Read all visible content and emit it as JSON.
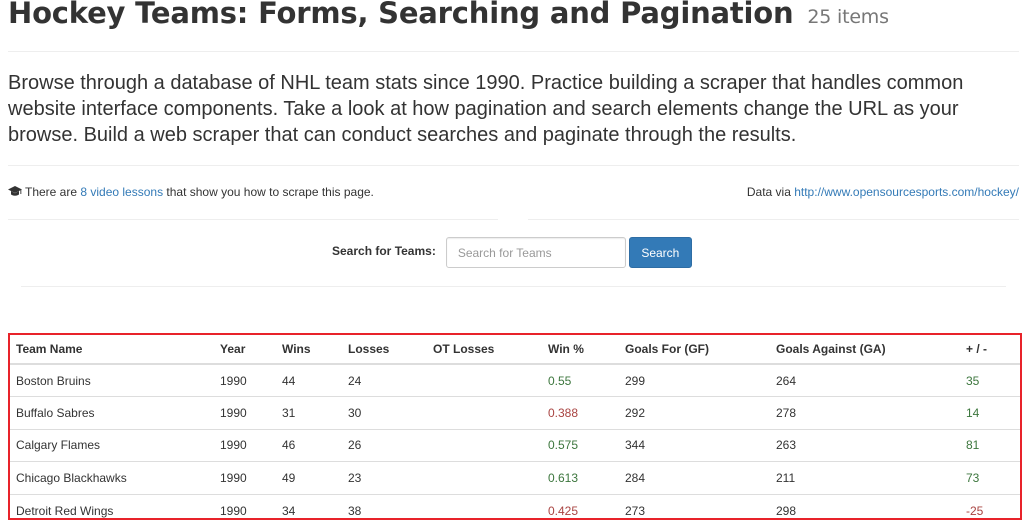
{
  "header": {
    "title": "Hockey Teams: Forms, Searching and Pagination",
    "count": "25 items"
  },
  "lead": "Browse through a database of NHL team stats since 1990. Practice building a scraper that handles common website interface components. Take a look at how pagination and search elements change the URL as your browse. Build a web scraper that can conduct searches and paginate through the results.",
  "info": {
    "prefix": "There are ",
    "video_link": "8 video lessons",
    "suffix": " that show you how to scrape this page.",
    "data_via": "Data via ",
    "data_link": "http://www.opensourcesports.com/hockey/",
    "icon": "graduation-cap-icon"
  },
  "search": {
    "label": "Search for Teams:",
    "placeholder": "Search for Teams",
    "value": "",
    "button_label": "Search"
  },
  "colors": {
    "link": "#337ab7",
    "button": "#337ab7",
    "positive": "#3c763d",
    "negative": "#a94442",
    "highlight_border": "#e8232a"
  },
  "table": {
    "headers": [
      "Team Name",
      "Year",
      "Wins",
      "Losses",
      "OT Losses",
      "Win %",
      "Goals For (GF)",
      "Goals Against (GA)",
      "+ / -"
    ],
    "rows": [
      {
        "name": "Boston Bruins",
        "year": "1990",
        "wins": "44",
        "losses": "24",
        "ot_losses": "",
        "win_pct": "0.55",
        "win_pct_status": "pos",
        "gf": "299",
        "ga": "264",
        "diff": "35",
        "diff_status": "pos"
      },
      {
        "name": "Buffalo Sabres",
        "year": "1990",
        "wins": "31",
        "losses": "30",
        "ot_losses": "",
        "win_pct": "0.388",
        "win_pct_status": "neg",
        "gf": "292",
        "ga": "278",
        "diff": "14",
        "diff_status": "pos"
      },
      {
        "name": "Calgary Flames",
        "year": "1990",
        "wins": "46",
        "losses": "26",
        "ot_losses": "",
        "win_pct": "0.575",
        "win_pct_status": "pos",
        "gf": "344",
        "ga": "263",
        "diff": "81",
        "diff_status": "pos"
      },
      {
        "name": "Chicago Blackhawks",
        "year": "1990",
        "wins": "49",
        "losses": "23",
        "ot_losses": "",
        "win_pct": "0.613",
        "win_pct_status": "pos",
        "gf": "284",
        "ga": "211",
        "diff": "73",
        "diff_status": "pos"
      },
      {
        "name": "Detroit Red Wings",
        "year": "1990",
        "wins": "34",
        "losses": "38",
        "ot_losses": "",
        "win_pct": "0.425",
        "win_pct_status": "neg",
        "gf": "273",
        "ga": "298",
        "diff": "-25",
        "diff_status": "neg"
      }
    ]
  }
}
